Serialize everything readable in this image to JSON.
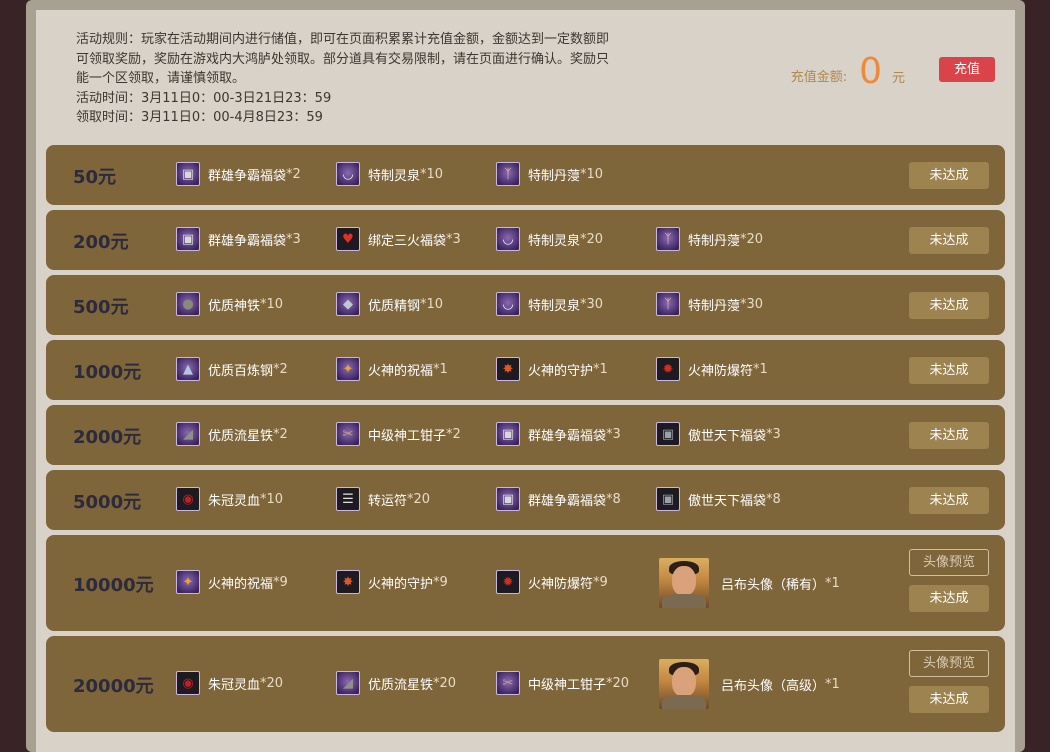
{
  "rules": {
    "line1": "活动规则：玩家在活动期间内进行储值，即可在页面积累累计充值金额，金额达到一定数额即",
    "line2": "可领取奖励，奖励在游戏内大鸿胪处领取。部分道具有交易限制，请在页面进行确认。奖励只",
    "line3": "能一个区领取，请谨慎领取。",
    "activity_time": "活动时间：3月11日0：00-3日21日23：59",
    "claim_time": "领取时间：3月11日0：00-4月8日23：59"
  },
  "recharge": {
    "label": "充值金额:",
    "amount": "0",
    "unit": "元",
    "button": "充值"
  },
  "colors": {
    "row_bg": "#7e653a",
    "tier_text": "#2c2b3e",
    "amount": "#ee8a3a",
    "recharge_button": "#d9434a",
    "status_button": "#9d8350"
  },
  "rows": [
    {
      "tier": "50元",
      "items": [
        {
          "name": "群雄争霸福袋",
          "count": "*2",
          "icon": "chest-icon"
        },
        {
          "name": "特制灵泉",
          "count": "*10",
          "icon": "bowl-icon"
        },
        {
          "name": "特制丹蓡",
          "count": "*10",
          "icon": "ginseng-icon"
        }
      ],
      "status": "未达成"
    },
    {
      "tier": "200元",
      "items": [
        {
          "name": "群雄争霸福袋",
          "count": "*3",
          "icon": "chest-icon"
        },
        {
          "name": "绑定三火福袋",
          "count": "*3",
          "icon": "fire-bag-icon"
        },
        {
          "name": "特制灵泉",
          "count": "*20",
          "icon": "bowl-icon"
        },
        {
          "name": "特制丹蓡",
          "count": "*20",
          "icon": "ginseng-icon"
        }
      ],
      "status": "未达成"
    },
    {
      "tier": "500元",
      "items": [
        {
          "name": "优质神铁",
          "count": "*10",
          "icon": "iron-ore-icon"
        },
        {
          "name": "优质精钢",
          "count": "*10",
          "icon": "steel-ore-icon"
        },
        {
          "name": "特制灵泉",
          "count": "*30",
          "icon": "bowl-icon"
        },
        {
          "name": "特制丹蓡",
          "count": "*30",
          "icon": "ginseng-icon"
        }
      ],
      "status": "未达成"
    },
    {
      "tier": "1000元",
      "items": [
        {
          "name": "优质百炼钢",
          "count": "*2",
          "icon": "crystal-icon"
        },
        {
          "name": "火神的祝福",
          "count": "*1",
          "icon": "blessing-scroll-icon"
        },
        {
          "name": "火神的守护",
          "count": "*1",
          "icon": "guard-talisman-icon"
        },
        {
          "name": "火神防爆符",
          "count": "*1",
          "icon": "explosion-charm-icon"
        }
      ],
      "status": "未达成"
    },
    {
      "tier": "2000元",
      "items": [
        {
          "name": "优质流星铁",
          "count": "*2",
          "icon": "meteor-iron-icon"
        },
        {
          "name": "中级神工钳子",
          "count": "*2",
          "icon": "tongs-icon"
        },
        {
          "name": "群雄争霸福袋",
          "count": "*3",
          "icon": "chest-icon"
        },
        {
          "name": "傲世天下福袋",
          "count": "*3",
          "icon": "dark-chest-icon"
        }
      ],
      "status": "未达成"
    },
    {
      "tier": "5000元",
      "items": [
        {
          "name": "朱冠灵血",
          "count": "*10",
          "icon": "blood-bowl-icon"
        },
        {
          "name": "转运符",
          "count": "*20",
          "icon": "luck-charm-icon"
        },
        {
          "name": "群雄争霸福袋",
          "count": "*8",
          "icon": "chest-icon"
        },
        {
          "name": "傲世天下福袋",
          "count": "*8",
          "icon": "dark-chest-icon"
        }
      ],
      "status": "未达成"
    },
    {
      "tier": "10000元",
      "items": [
        {
          "name": "火神的祝福",
          "count": "*9",
          "icon": "blessing-scroll-icon"
        },
        {
          "name": "火神的守护",
          "count": "*9",
          "icon": "guard-talisman-icon"
        },
        {
          "name": "火神防爆符",
          "count": "*9",
          "icon": "explosion-charm-icon"
        }
      ],
      "portrait": {
        "name": "吕布头像（稀有）",
        "count": "*1"
      },
      "preview": "头像预览",
      "status": "未达成"
    },
    {
      "tier": "20000元",
      "items": [
        {
          "name": "朱冠灵血",
          "count": "*20",
          "icon": "blood-bowl-icon"
        },
        {
          "name": "优质流星铁",
          "count": "*20",
          "icon": "meteor-iron-icon"
        },
        {
          "name": "中级神工钳子",
          "count": "*20",
          "icon": "tongs-icon"
        }
      ],
      "portrait": {
        "name": "吕布头像（高级）",
        "count": "*1"
      },
      "preview": "头像预览",
      "status": "未达成"
    }
  ]
}
